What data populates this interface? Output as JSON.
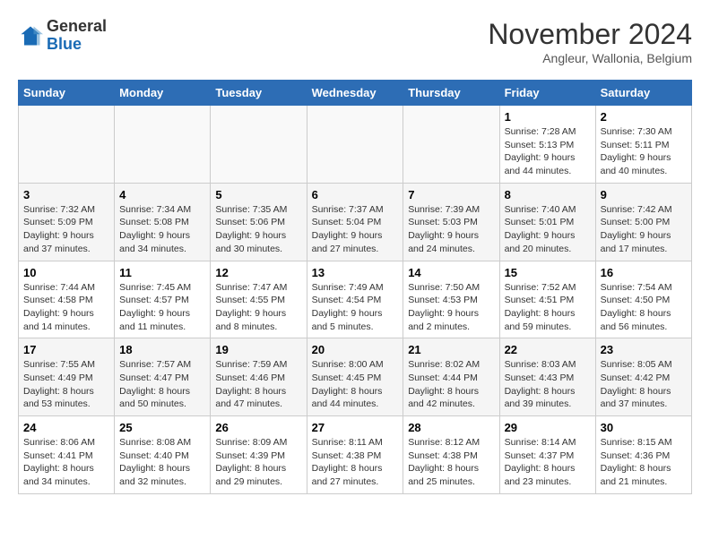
{
  "logo": {
    "general": "General",
    "blue": "Blue"
  },
  "header": {
    "title": "November 2024",
    "subtitle": "Angleur, Wallonia, Belgium"
  },
  "days_of_week": [
    "Sunday",
    "Monday",
    "Tuesday",
    "Wednesday",
    "Thursday",
    "Friday",
    "Saturday"
  ],
  "weeks": [
    [
      {
        "day": "",
        "info": ""
      },
      {
        "day": "",
        "info": ""
      },
      {
        "day": "",
        "info": ""
      },
      {
        "day": "",
        "info": ""
      },
      {
        "day": "",
        "info": ""
      },
      {
        "day": "1",
        "info": "Sunrise: 7:28 AM\nSunset: 5:13 PM\nDaylight: 9 hours and 44 minutes."
      },
      {
        "day": "2",
        "info": "Sunrise: 7:30 AM\nSunset: 5:11 PM\nDaylight: 9 hours and 40 minutes."
      }
    ],
    [
      {
        "day": "3",
        "info": "Sunrise: 7:32 AM\nSunset: 5:09 PM\nDaylight: 9 hours and 37 minutes."
      },
      {
        "day": "4",
        "info": "Sunrise: 7:34 AM\nSunset: 5:08 PM\nDaylight: 9 hours and 34 minutes."
      },
      {
        "day": "5",
        "info": "Sunrise: 7:35 AM\nSunset: 5:06 PM\nDaylight: 9 hours and 30 minutes."
      },
      {
        "day": "6",
        "info": "Sunrise: 7:37 AM\nSunset: 5:04 PM\nDaylight: 9 hours and 27 minutes."
      },
      {
        "day": "7",
        "info": "Sunrise: 7:39 AM\nSunset: 5:03 PM\nDaylight: 9 hours and 24 minutes."
      },
      {
        "day": "8",
        "info": "Sunrise: 7:40 AM\nSunset: 5:01 PM\nDaylight: 9 hours and 20 minutes."
      },
      {
        "day": "9",
        "info": "Sunrise: 7:42 AM\nSunset: 5:00 PM\nDaylight: 9 hours and 17 minutes."
      }
    ],
    [
      {
        "day": "10",
        "info": "Sunrise: 7:44 AM\nSunset: 4:58 PM\nDaylight: 9 hours and 14 minutes."
      },
      {
        "day": "11",
        "info": "Sunrise: 7:45 AM\nSunset: 4:57 PM\nDaylight: 9 hours and 11 minutes."
      },
      {
        "day": "12",
        "info": "Sunrise: 7:47 AM\nSunset: 4:55 PM\nDaylight: 9 hours and 8 minutes."
      },
      {
        "day": "13",
        "info": "Sunrise: 7:49 AM\nSunset: 4:54 PM\nDaylight: 9 hours and 5 minutes."
      },
      {
        "day": "14",
        "info": "Sunrise: 7:50 AM\nSunset: 4:53 PM\nDaylight: 9 hours and 2 minutes."
      },
      {
        "day": "15",
        "info": "Sunrise: 7:52 AM\nSunset: 4:51 PM\nDaylight: 8 hours and 59 minutes."
      },
      {
        "day": "16",
        "info": "Sunrise: 7:54 AM\nSunset: 4:50 PM\nDaylight: 8 hours and 56 minutes."
      }
    ],
    [
      {
        "day": "17",
        "info": "Sunrise: 7:55 AM\nSunset: 4:49 PM\nDaylight: 8 hours and 53 minutes."
      },
      {
        "day": "18",
        "info": "Sunrise: 7:57 AM\nSunset: 4:47 PM\nDaylight: 8 hours and 50 minutes."
      },
      {
        "day": "19",
        "info": "Sunrise: 7:59 AM\nSunset: 4:46 PM\nDaylight: 8 hours and 47 minutes."
      },
      {
        "day": "20",
        "info": "Sunrise: 8:00 AM\nSunset: 4:45 PM\nDaylight: 8 hours and 44 minutes."
      },
      {
        "day": "21",
        "info": "Sunrise: 8:02 AM\nSunset: 4:44 PM\nDaylight: 8 hours and 42 minutes."
      },
      {
        "day": "22",
        "info": "Sunrise: 8:03 AM\nSunset: 4:43 PM\nDaylight: 8 hours and 39 minutes."
      },
      {
        "day": "23",
        "info": "Sunrise: 8:05 AM\nSunset: 4:42 PM\nDaylight: 8 hours and 37 minutes."
      }
    ],
    [
      {
        "day": "24",
        "info": "Sunrise: 8:06 AM\nSunset: 4:41 PM\nDaylight: 8 hours and 34 minutes."
      },
      {
        "day": "25",
        "info": "Sunrise: 8:08 AM\nSunset: 4:40 PM\nDaylight: 8 hours and 32 minutes."
      },
      {
        "day": "26",
        "info": "Sunrise: 8:09 AM\nSunset: 4:39 PM\nDaylight: 8 hours and 29 minutes."
      },
      {
        "day": "27",
        "info": "Sunrise: 8:11 AM\nSunset: 4:38 PM\nDaylight: 8 hours and 27 minutes."
      },
      {
        "day": "28",
        "info": "Sunrise: 8:12 AM\nSunset: 4:38 PM\nDaylight: 8 hours and 25 minutes."
      },
      {
        "day": "29",
        "info": "Sunrise: 8:14 AM\nSunset: 4:37 PM\nDaylight: 8 hours and 23 minutes."
      },
      {
        "day": "30",
        "info": "Sunrise: 8:15 AM\nSunset: 4:36 PM\nDaylight: 8 hours and 21 minutes."
      }
    ]
  ]
}
